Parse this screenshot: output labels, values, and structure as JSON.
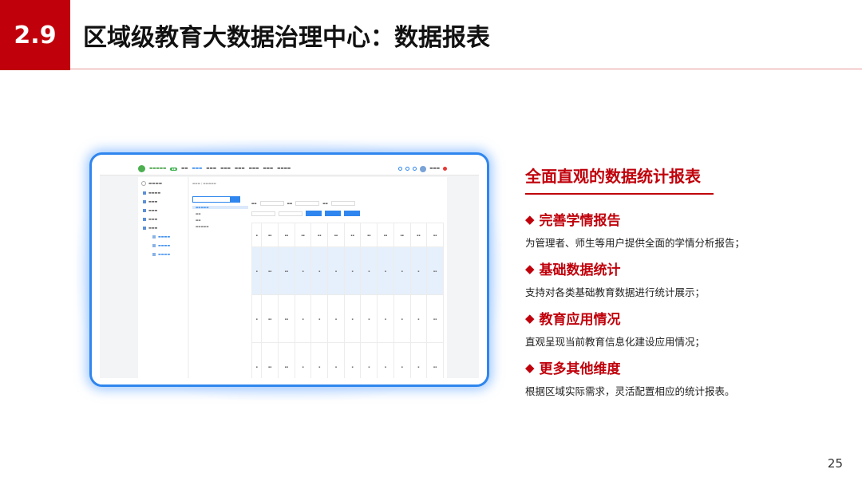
{
  "header": {
    "section_number": "2.9",
    "title": "区域级教育大数据治理中心：数据报表"
  },
  "panel": {
    "title": "全面直观的数据统计报表",
    "items": [
      {
        "heading": "完善学情报告",
        "desc": "为管理者、师生等用户提供全面的学情分析报告；"
      },
      {
        "heading": "基础数据统计",
        "desc": "支持对各类基础教育数据进行统计展示；"
      },
      {
        "heading": "教育应用情况",
        "desc": "直观呈现当前教育信息化建设应用情况；"
      },
      {
        "heading": "更多其他维度",
        "desc": "根据区域实际需求，灵活配置相应的统计报表。"
      }
    ],
    "bullet_glyph": "◆"
  },
  "footer": {
    "page_number": "25"
  },
  "colors": {
    "accent": "#c0000b",
    "device_frame": "#2f86ee"
  }
}
